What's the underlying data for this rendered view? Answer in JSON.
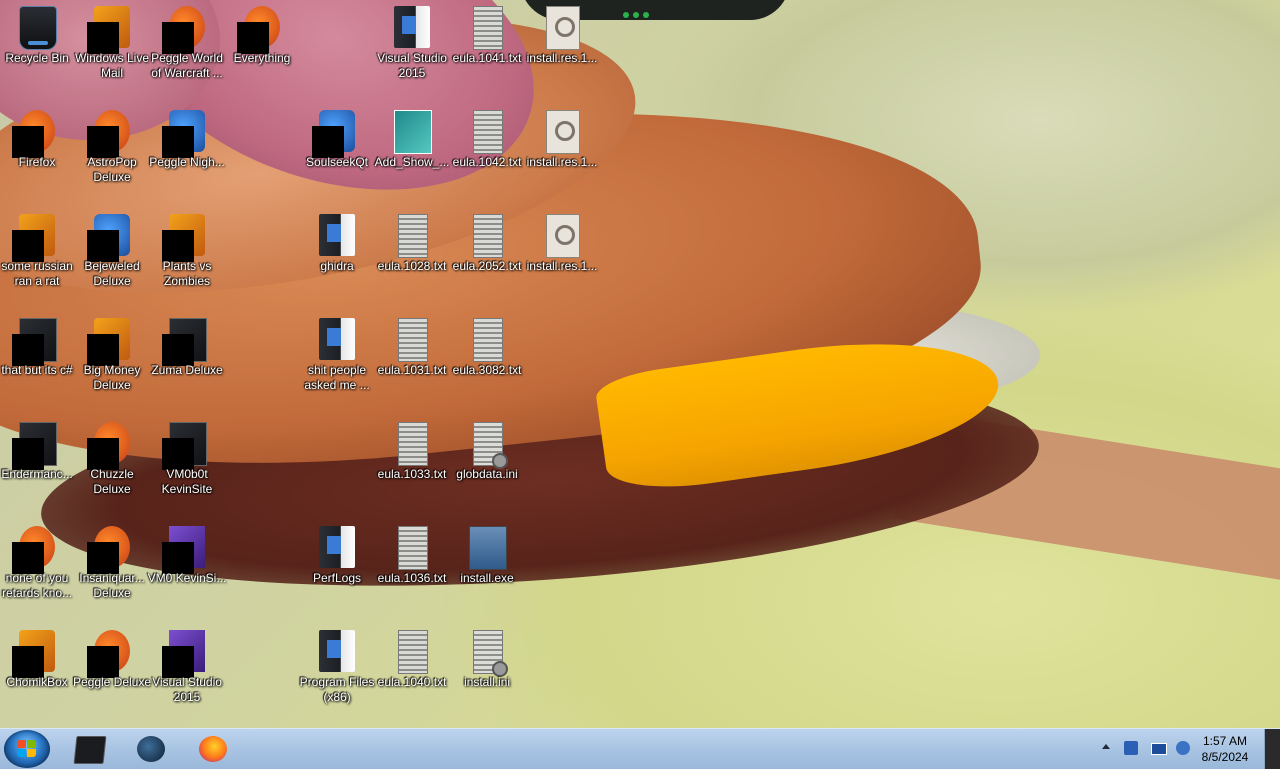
{
  "desktop": {
    "icons": [
      {
        "label": "Recycle Bin",
        "icon": "recycle-bin-icon"
      },
      {
        "label": "Windows Live Mail",
        "icon": "live-mail-icon"
      },
      {
        "label": "Peggle World of Warcraft ...",
        "icon": "peggle-wow-icon"
      },
      {
        "label": "Everything",
        "icon": "everything-icon"
      },
      {
        "label": "Visual Studio 2015",
        "icon": "folder-icon"
      },
      {
        "label": "eula.1041.txt",
        "icon": "text-file-icon"
      },
      {
        "label": "install.res.1...",
        "icon": "resource-file-icon"
      },
      {
        "label": "Firefox",
        "icon": "firefox-icon"
      },
      {
        "label": "AstroPop Deluxe",
        "icon": "astropop-icon"
      },
      {
        "label": "Peggle Nigh...",
        "icon": "peggle-nights-icon"
      },
      {
        "label": "SoulseekQt",
        "icon": "soulseek-icon"
      },
      {
        "label": "Add_Show_...",
        "icon": "registry-file-icon"
      },
      {
        "label": "eula.1042.txt",
        "icon": "text-file-icon"
      },
      {
        "label": "install.res.1...",
        "icon": "resource-file-icon"
      },
      {
        "label": "some russian ran a rat",
        "icon": "app-icon"
      },
      {
        "label": "Bejeweled Deluxe",
        "icon": "bejeweled-icon"
      },
      {
        "label": "Plants vs Zombies",
        "icon": "pvz-icon"
      },
      {
        "label": "ghidra",
        "icon": "folder-icon"
      },
      {
        "label": "eula.1028.txt",
        "icon": "text-file-icon"
      },
      {
        "label": "eula.2052.txt",
        "icon": "text-file-icon"
      },
      {
        "label": "install.res.1...",
        "icon": "resource-file-icon"
      },
      {
        "label": "that but its c#",
        "icon": "document-icon"
      },
      {
        "label": "Big Money Deluxe",
        "icon": "big-money-icon"
      },
      {
        "label": "Zuma Deluxe",
        "icon": "zuma-icon"
      },
      {
        "label": "shit people asked me ...",
        "icon": "folder-icon"
      },
      {
        "label": "eula.1031.txt",
        "icon": "text-file-icon"
      },
      {
        "label": "eula.3082.txt",
        "icon": "text-file-icon"
      },
      {
        "label": "Endermanc...",
        "icon": "app-icon"
      },
      {
        "label": "Chuzzle Deluxe",
        "icon": "chuzzle-icon"
      },
      {
        "label": "VM0b0t KevinSite",
        "icon": "vm-icon"
      },
      {
        "label": "eula.1033.txt",
        "icon": "text-file-icon"
      },
      {
        "label": "globdata.ini",
        "icon": "ini-file-icon"
      },
      {
        "label": "none of you retards kno...",
        "icon": "app-icon"
      },
      {
        "label": "Insaniquar... Deluxe",
        "icon": "insaniquarium-icon"
      },
      {
        "label": "VM0 KevinSi...",
        "icon": "vm-icon"
      },
      {
        "label": "PerfLogs",
        "icon": "folder-icon"
      },
      {
        "label": "eula.1036.txt",
        "icon": "text-file-icon"
      },
      {
        "label": "install.exe",
        "icon": "installer-icon"
      },
      {
        "label": "ChomikBox",
        "icon": "chomikbox-icon"
      },
      {
        "label": "Peggle Deluxe",
        "icon": "peggle-icon"
      },
      {
        "label": "Visual Studio 2015",
        "icon": "visual-studio-icon"
      },
      {
        "label": "Program Files (x86)",
        "icon": "folder-icon"
      },
      {
        "label": "eula.1040.txt",
        "icon": "text-file-icon"
      },
      {
        "label": "install.ini",
        "icon": "ini-file-icon"
      }
    ]
  },
  "taskbar": {
    "start": {
      "icon": "windows-start-icon"
    },
    "pinned": [
      {
        "name": "command-prompt",
        "icon": "cmd-icon"
      },
      {
        "name": "ghidra",
        "icon": "ghidra-icon"
      },
      {
        "name": "firefox",
        "icon": "firefox-icon"
      }
    ],
    "tray": {
      "time": "1:57 AM",
      "date": "8/5/2024"
    }
  },
  "colors": {
    "taskbar": "#a9c4e3",
    "label_text": "#ffffff",
    "cheese": "#f6a400"
  }
}
